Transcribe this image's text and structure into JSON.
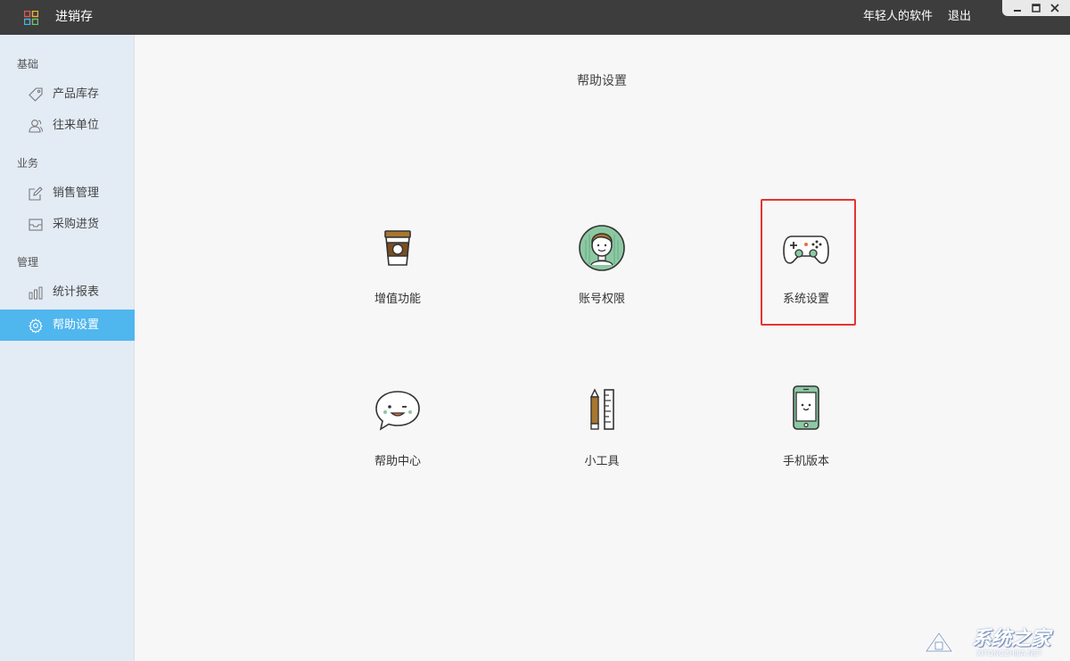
{
  "titlebar": {
    "app_title": "进销存",
    "user_name": "年轻人的软件",
    "logout_label": "退出"
  },
  "sidebar": {
    "sections": [
      {
        "heading": "基础",
        "items": [
          {
            "label": "产品库存",
            "icon": "tag-icon"
          },
          {
            "label": "往来单位",
            "icon": "contacts-icon"
          }
        ]
      },
      {
        "heading": "业务",
        "items": [
          {
            "label": "销售管理",
            "icon": "edit-icon"
          },
          {
            "label": "采购进货",
            "icon": "inbox-icon"
          }
        ]
      },
      {
        "heading": "管理",
        "items": [
          {
            "label": "统计报表",
            "icon": "bar-chart-icon"
          },
          {
            "label": "帮助设置",
            "icon": "gear-icon",
            "active": true
          }
        ]
      }
    ]
  },
  "main": {
    "title": "帮助设置",
    "tiles": [
      {
        "label": "增值功能",
        "icon": "coffee-cup-icon"
      },
      {
        "label": "账号权限",
        "icon": "user-avatar-icon"
      },
      {
        "label": "系统设置",
        "icon": "gamepad-icon",
        "highlighted": true
      },
      {
        "label": "帮助中心",
        "icon": "chat-bubble-icon"
      },
      {
        "label": "小工具",
        "icon": "pencil-ruler-icon"
      },
      {
        "label": "手机版本",
        "icon": "mobile-phone-icon"
      }
    ]
  },
  "watermark": {
    "text": "系统之家",
    "url": "XITONGZHIJIA.NET"
  },
  "colors": {
    "titlebar_bg": "#3d3d3d",
    "sidebar_bg": "#e3ebf5",
    "active_bg": "#50b6ee",
    "highlight": "#e63333",
    "icon_green": "#8cc9a3",
    "icon_brown": "#a8762e"
  }
}
